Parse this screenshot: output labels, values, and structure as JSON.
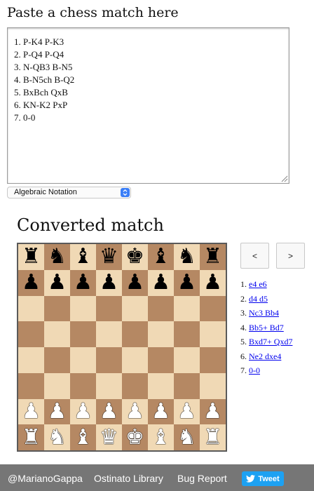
{
  "input_section": {
    "heading": "Paste a chess match here",
    "match_text": "1. P-K4 P-K3\n2. P-Q4 P-Q4\n3. N-QB3 B-N5\n4. B-N5ch B-Q2\n5. BxBch QxB\n6. KN-K2 PxP\n7. 0-0",
    "notation_select": {
      "selected": "Algebraic Notation",
      "options": [
        "Algebraic Notation"
      ]
    }
  },
  "output_section": {
    "heading": "Converted match",
    "prev_label": "<",
    "next_label": ">",
    "moves": [
      {
        "number": "1.",
        "text": "e4 e6"
      },
      {
        "number": "2.",
        "text": "d4 d5"
      },
      {
        "number": "3.",
        "text": "Nc3 Bb4"
      },
      {
        "number": "4.",
        "text": "Bb5+ Bd7"
      },
      {
        "number": "5.",
        "text": "Bxd7+ Qxd7"
      },
      {
        "number": "6.",
        "text": "Ne2 dxe4"
      },
      {
        "number": "7.",
        "text": "0-0"
      }
    ]
  },
  "board": {
    "ranks": [
      [
        "br",
        "bn",
        "bb",
        "bq",
        "bk",
        "bb",
        "bn",
        "br"
      ],
      [
        "bp",
        "bp",
        "bp",
        "bp",
        "bp",
        "bp",
        "bp",
        "bp"
      ],
      [
        "",
        "",
        "",
        "",
        "",
        "",
        "",
        ""
      ],
      [
        "",
        "",
        "",
        "",
        "",
        "",
        "",
        ""
      ],
      [
        "",
        "",
        "",
        "",
        "",
        "",
        "",
        ""
      ],
      [
        "",
        "",
        "",
        "",
        "",
        "",
        "",
        ""
      ],
      [
        "wp",
        "wp",
        "wp",
        "wp",
        "wp",
        "wp",
        "wp",
        "wp"
      ],
      [
        "wr",
        "wn",
        "wb",
        "wq",
        "wk",
        "wb",
        "wn",
        "wr"
      ]
    ],
    "light_color": "#f0d9b5",
    "dark_color": "#b58863"
  },
  "footer": {
    "author_link": "@MarianoGappa",
    "library_link": "Ostinato Library",
    "bug_link": "Bug Report",
    "tweet_label": "Tweet",
    "background_color": "#767676",
    "tweet_color": "#1da1f2"
  }
}
